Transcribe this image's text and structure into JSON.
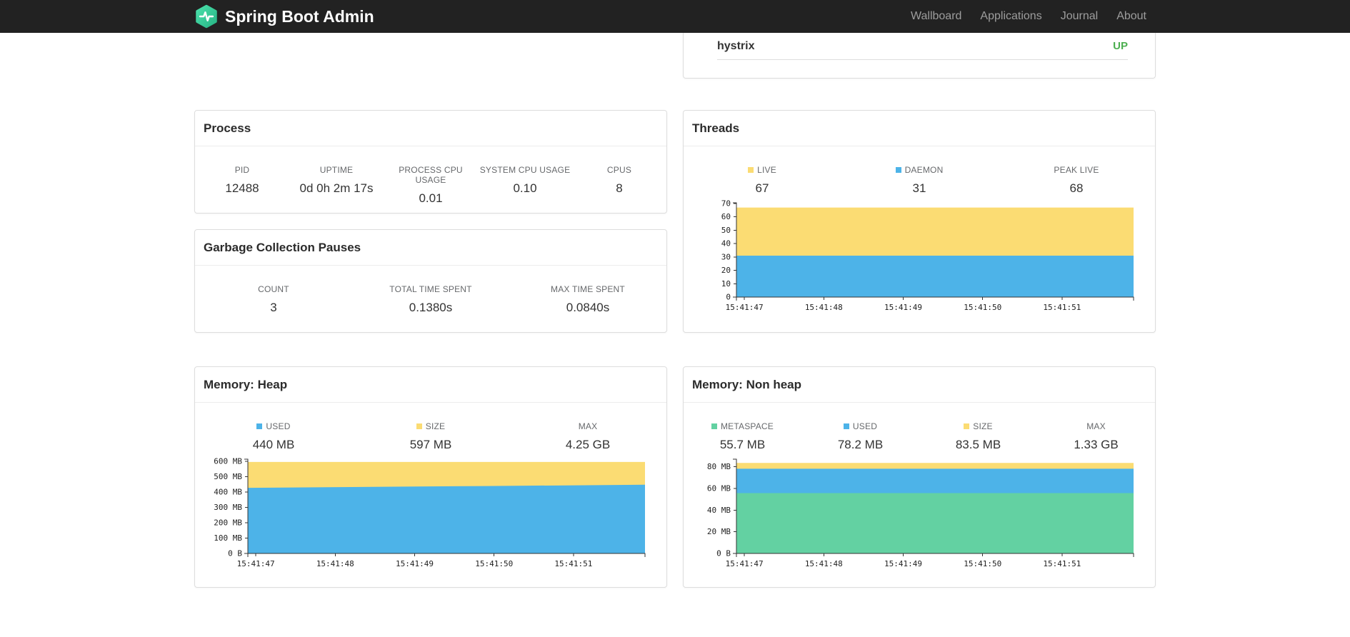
{
  "navbar": {
    "brand": "Spring Boot Admin",
    "links": [
      {
        "label": "Wallboard"
      },
      {
        "label": "Applications"
      },
      {
        "label": "Journal"
      },
      {
        "label": "About"
      }
    ]
  },
  "applications_card": {
    "app_name": "hystrix",
    "status": "UP",
    "status_color": "#4caf50"
  },
  "process_card": {
    "title": "Process",
    "stats": [
      {
        "label": "PID",
        "value": "12488"
      },
      {
        "label": "UPTIME",
        "value": "0d 0h 2m 17s"
      },
      {
        "label": "PROCESS CPU USAGE",
        "value": "0.01"
      },
      {
        "label": "SYSTEM CPU USAGE",
        "value": "0.10"
      },
      {
        "label": "CPUS",
        "value": "8"
      }
    ]
  },
  "gc_card": {
    "title": "Garbage Collection Pauses",
    "stats": [
      {
        "label": "COUNT",
        "value": "3"
      },
      {
        "label": "TOTAL TIME SPENT",
        "value": "0.1380s"
      },
      {
        "label": "MAX TIME SPENT",
        "value": "0.0840s"
      }
    ]
  },
  "threads_card": {
    "title": "Threads",
    "stats": [
      {
        "label": "LIVE",
        "value": "67",
        "marker": "#fbdc73"
      },
      {
        "label": "DAEMON",
        "value": "31",
        "marker": "#4db3e8"
      },
      {
        "label": "PEAK LIVE",
        "value": "68"
      }
    ]
  },
  "heap_card": {
    "title": "Memory: Heap",
    "stats": [
      {
        "label": "USED",
        "value": "440 MB",
        "marker": "#4db3e8"
      },
      {
        "label": "SIZE",
        "value": "597 MB",
        "marker": "#fbdc73"
      },
      {
        "label": "MAX",
        "value": "4.25 GB"
      }
    ]
  },
  "nonheap_card": {
    "title": "Memory: Non heap",
    "stats": [
      {
        "label": "METASPACE",
        "value": "55.7 MB",
        "marker": "#63d1a2"
      },
      {
        "label": "USED",
        "value": "78.2 MB",
        "marker": "#4db3e8"
      },
      {
        "label": "SIZE",
        "value": "83.5 MB",
        "marker": "#fbdc73"
      },
      {
        "label": "MAX",
        "value": "1.33 GB"
      }
    ]
  },
  "colors": {
    "navbar_bg": "#222222",
    "brand_teal": "#3ecf9e",
    "status_up_green": "#4caf50",
    "series_blue": "#4db3e8",
    "series_yellow": "#fbdc73",
    "series_green": "#63d1a2"
  },
  "chart_data": [
    {
      "name": "threads",
      "type": "area",
      "title": "Threads",
      "xlabel": "time",
      "ylabel": "threads",
      "grid": false,
      "legend_position": "above",
      "x_ticks": [
        "15:41:47",
        "15:41:48",
        "15:41:49",
        "15:41:50",
        "15:41:51"
      ],
      "x_tick_fractions": [
        0.02,
        0.22,
        0.42,
        0.62,
        0.82
      ],
      "y_ticks": {
        "values": [
          0,
          10,
          20,
          30,
          40,
          50,
          60,
          70
        ],
        "labels": [
          "0",
          "10",
          "20",
          "30",
          "40",
          "50",
          "60",
          "70"
        ]
      },
      "ylim": [
        0,
        70.5
      ],
      "series": [
        {
          "name": "LIVE",
          "color": "#fbdc73",
          "values": [
            67,
            67,
            67,
            67,
            67,
            67
          ]
        },
        {
          "name": "DAEMON",
          "color": "#4db3e8",
          "values": [
            31,
            31,
            31,
            31,
            31,
            31
          ]
        }
      ]
    },
    {
      "name": "memory-heap",
      "type": "area",
      "title": "Memory: Heap",
      "xlabel": "time",
      "ylabel": "MB",
      "grid": false,
      "legend_position": "above",
      "x_ticks": [
        "15:41:47",
        "15:41:48",
        "15:41:49",
        "15:41:50",
        "15:41:51"
      ],
      "x_tick_fractions": [
        0.02,
        0.22,
        0.42,
        0.62,
        0.82
      ],
      "y_ticks": {
        "values": [
          0,
          100,
          200,
          300,
          400,
          500,
          600
        ],
        "labels": [
          "0 B",
          "100 MB",
          "200 MB",
          "300 MB",
          "400 MB",
          "500 MB",
          "600 MB"
        ]
      },
      "ylim": [
        0,
        615
      ],
      "series": [
        {
          "name": "SIZE",
          "color": "#fbdc73",
          "values": [
            597,
            597,
            597,
            597,
            597,
            597
          ]
        },
        {
          "name": "USED",
          "color": "#4db3e8",
          "values": [
            428,
            432,
            436,
            440,
            444,
            448
          ]
        }
      ]
    },
    {
      "name": "memory-nonheap",
      "type": "area",
      "title": "Memory: Non heap",
      "xlabel": "time",
      "ylabel": "MB",
      "grid": false,
      "legend_position": "above",
      "x_ticks": [
        "15:41:47",
        "15:41:48",
        "15:41:49",
        "15:41:50",
        "15:41:51"
      ],
      "x_tick_fractions": [
        0.02,
        0.22,
        0.42,
        0.62,
        0.82
      ],
      "y_ticks": {
        "values": [
          0,
          20,
          40,
          60,
          80
        ],
        "labels": [
          "0 B",
          "20 MB",
          "40 MB",
          "60 MB",
          "80 MB"
        ]
      },
      "ylim": [
        0,
        87
      ],
      "series": [
        {
          "name": "SIZE",
          "color": "#fbdc73",
          "values": [
            83.5,
            83.5,
            83.5,
            83.5,
            83.5,
            83.5
          ]
        },
        {
          "name": "USED",
          "color": "#4db3e8",
          "values": [
            78.2,
            78.2,
            78.2,
            78.2,
            78.2,
            78.2
          ]
        },
        {
          "name": "METASPACE",
          "color": "#63d1a2",
          "values": [
            55.7,
            55.7,
            55.7,
            55.7,
            55.7,
            55.7
          ]
        }
      ]
    }
  ]
}
